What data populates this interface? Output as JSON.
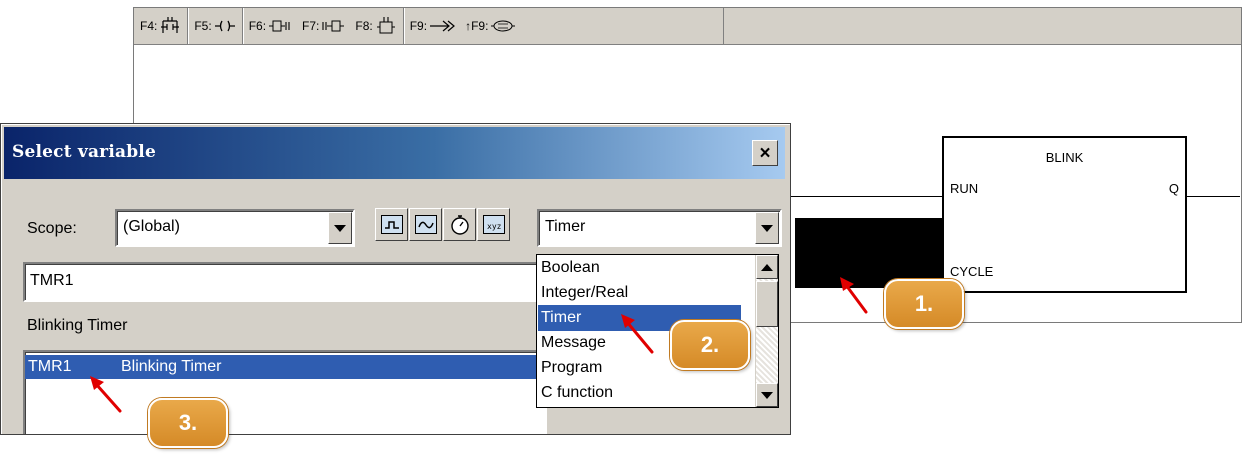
{
  "toolbar": {
    "keys": [
      {
        "label": "F4:",
        "icon": "contact-block-icon"
      },
      {
        "label": "F5:",
        "icon": "coil-icon"
      },
      {
        "label": "F6:",
        "icon": "block-before-icon"
      },
      {
        "label": "F7:",
        "icon": "block-after-icon"
      },
      {
        "label": "F8:",
        "icon": "block-parallel-icon"
      },
      {
        "label": "F9:",
        "icon": "jump-icon"
      },
      {
        "label": "↑F9:",
        "icon": "return-icon"
      }
    ]
  },
  "diagram": {
    "block_name": "BLINK",
    "pin_run": "RUN",
    "pin_q": "Q",
    "pin_cycle": "CYCLE"
  },
  "dialog": {
    "title": "Select variable",
    "close_label": "×",
    "scope_label": "Scope:",
    "scope_value": "(Global)",
    "type_value": "Timer",
    "name_value": "TMR1",
    "comment_text": "Blinking Timer",
    "type_buttons": [
      "boolean-type-icon",
      "analog-type-icon",
      "timer-type-icon",
      "message-type-icon"
    ],
    "list": [
      {
        "name": "TMR1",
        "comment": "Blinking Timer",
        "selected": true
      }
    ]
  },
  "type_dropdown": {
    "options": [
      "Boolean",
      "Integer/Real",
      "Timer",
      "Message",
      "Program",
      "C function"
    ],
    "selected": "Timer"
  },
  "callouts": [
    "1.",
    "2.",
    "3."
  ],
  "colors": {
    "selection": "#2f5db1",
    "callout": "#e09a3a",
    "arrow": "#e00000",
    "titlebar_start": "#0a246a",
    "titlebar_end": "#a6caf0"
  }
}
